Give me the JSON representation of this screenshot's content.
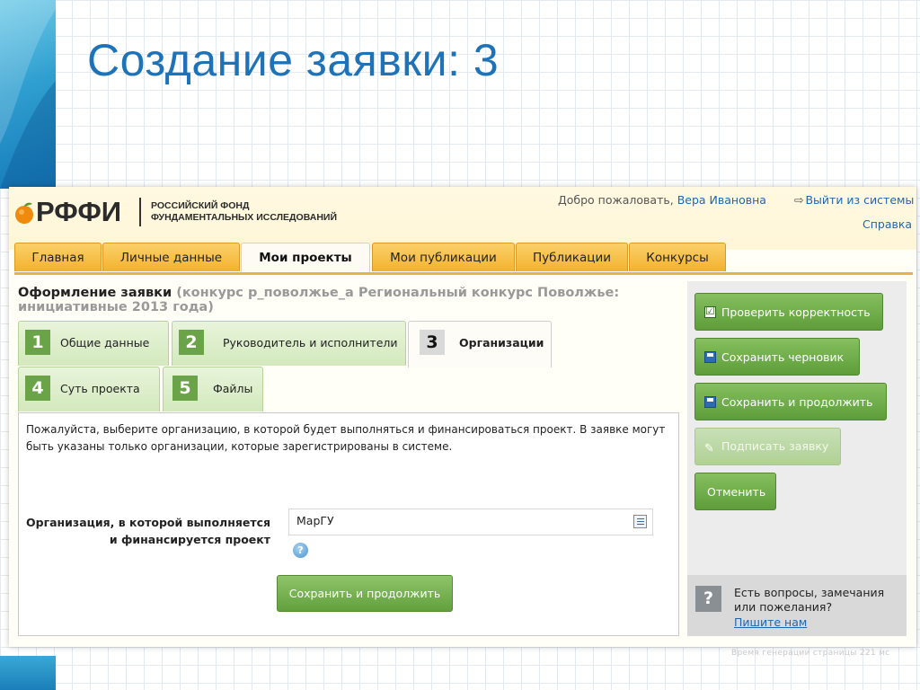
{
  "slide": {
    "title": "Создание заявки: 3"
  },
  "brand": {
    "logo_text": "РФФИ",
    "org_name_line1": "РОССИЙСКИЙ ФОНД",
    "org_name_line2": "ФУНДАМЕНТАЛЬНЫХ ИССЛЕДОВАНИЙ"
  },
  "header": {
    "welcome": "Добро пожаловать, ",
    "user": "Вера Ивановна",
    "logout": "Выйти из системы",
    "help": "Справка"
  },
  "nav": {
    "tabs": [
      {
        "label": "Главная"
      },
      {
        "label": "Личные данные"
      },
      {
        "label": "Мои проекты",
        "active": true
      },
      {
        "label": "Мои публикации"
      },
      {
        "label": "Публикации"
      },
      {
        "label": "Конкурсы"
      }
    ]
  },
  "application": {
    "title": "Оформление заявки",
    "subtitle": "(конкурс р_поволжье_а Региональный конкурс Поволжье: инициативные 2013 года)"
  },
  "steps": [
    {
      "num": "1",
      "label": "Общие данные"
    },
    {
      "num": "2",
      "label": "Руководитель и исполнители"
    },
    {
      "num": "3",
      "label": "Организации",
      "active": true
    },
    {
      "num": "4",
      "label": "Суть проекта"
    },
    {
      "num": "5",
      "label": "Файлы"
    }
  ],
  "form": {
    "intro": "Пожалуйста, выберите организацию, в которой будет выполняться и финансироваться проект. В заявке могут быть указаны только организации, которые зарегистрированы в системе.",
    "org_label_line1": "Организация, в которой выполняется",
    "org_label_line2": "и финансируется проект",
    "org_value": "МарГУ",
    "save_continue": "Сохранить и продолжить"
  },
  "sidebar": {
    "check": "Проверить корректность",
    "save_draft": "Сохранить черновик",
    "save_continue": "Сохранить и продолжить",
    "sign": "Подписать заявку",
    "cancel": "Отменить",
    "feedback_text": "Есть вопросы, замечания или пожелания?",
    "feedback_link": "Пишите нам"
  },
  "footer": {
    "gentime": "Время генерации страницы 221 мс"
  },
  "colors": {
    "title_blue": "#1e73b8",
    "nav_orange": "#f3b12d",
    "button_green": "#62a03d",
    "link_blue": "#1f66b0"
  }
}
